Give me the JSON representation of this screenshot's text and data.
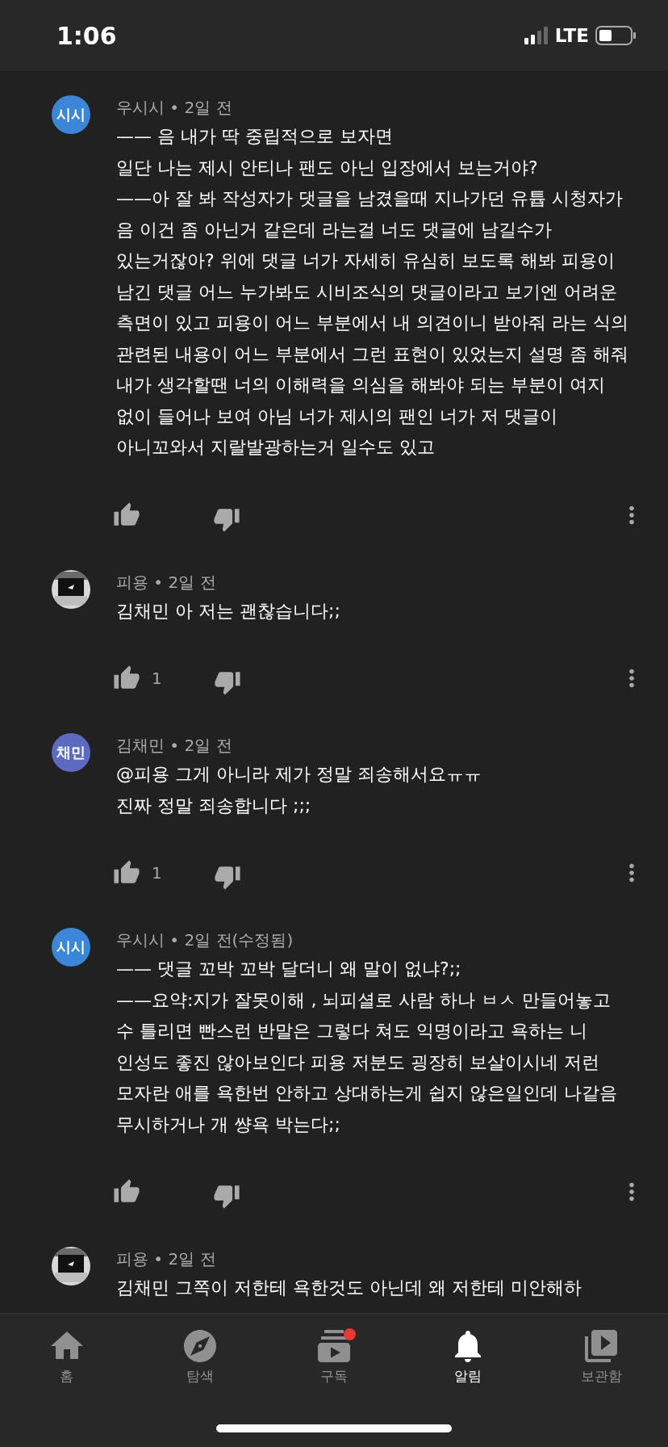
{
  "status_bar": {
    "time": "1:06",
    "network": "LTE"
  },
  "comments": [
    {
      "author": "우시시",
      "sep": "•",
      "time": "2일 전",
      "avatar": {
        "kind": "initials",
        "text": "시시",
        "color": "#3b86d6"
      },
      "text": "—— 음 내가 딱 중립적으로 보자면\n일단 나는 제시 안티나 팬도 아닌 입장에서 보는거야?\n——아 잘 봐 작성자가 댓글을 남겼을때 지나가던 유튭 시청자가 음 이건 좀 아닌거 같은데 라는걸 너도 댓글에 남길수가 있는거잖아? 위에 댓글 너가 자세히 유심히 보도록 해봐 피용이 남긴 댓글 어느 누가봐도 시비조식의 댓글이라고 보기엔 어려운 측면이 있고 피용이 어느 부분에서 내 의견이니 받아줘 라는 식의 관련된 내용이 어느 부분에서 그런 표현이 있었는지 설명 좀 해줘 내가 생각할땐 너의 이해력을 의심을 해봐야 되는 부분이 여지 없이 들어나 보여 아님 너가 제시의 팬인 너가 저 댓글이 아니꼬와서 지랄발광하는거 일수도 있고"
    },
    {
      "author": "피용",
      "sep": "•",
      "time": "2일 전",
      "text": "김채민 아 저는 괜찮습니다;;",
      "likes": "1"
    },
    {
      "author": "김채민",
      "sep": "•",
      "time": "2일 전",
      "avatar": {
        "kind": "initials",
        "text": "채민",
        "color": "#5c6bc0"
      },
      "text": "@피용 그게 아니라 제가 정말 죄송해서요ㅠㅠ\n진짜 정말 죄송합니다 ;;;",
      "likes": "1"
    },
    {
      "author": "우시시",
      "sep": "•",
      "time": "2일 전(수정됨)",
      "avatar": {
        "kind": "initials",
        "text": "시시",
        "color": "#3b86d6"
      },
      "text": "—— 댓글 꼬박 꼬박 달더니 왜 말이 없냐?;;\n——요약:지가 잘못이해 , 뇌피셜로 사람 하나 ㅂㅅ 만들어놓고\n수 틀리면 빤스런 반말은 그렇다 쳐도 익명이라고 욕하는 니 인성도 좋진 않아보인다 피용 저분도 굉장히 보살이시네 저런 모자란 애를 욕한번 안하고 상대하는게 쉽지 않은일인데 나같음 무시하거나 개 썅욕 박는다;;"
    },
    {
      "author": "피용",
      "sep": "•",
      "time": "2일 전",
      "text": "김채민 그쪽이 저한테 욕한것도 아닌데 왜 저한테 미안해하",
      "actions": false
    }
  ],
  "nav": [
    {
      "kind": "home",
      "label": "홈",
      "selected": false
    },
    {
      "kind": "explore",
      "label": "탐색",
      "selected": false
    },
    {
      "kind": "subscriptions",
      "label": "구독",
      "selected": false,
      "badge": true
    },
    {
      "kind": "notifications",
      "label": "알림",
      "selected": true
    },
    {
      "kind": "library",
      "label": "보관함",
      "selected": false
    }
  ]
}
